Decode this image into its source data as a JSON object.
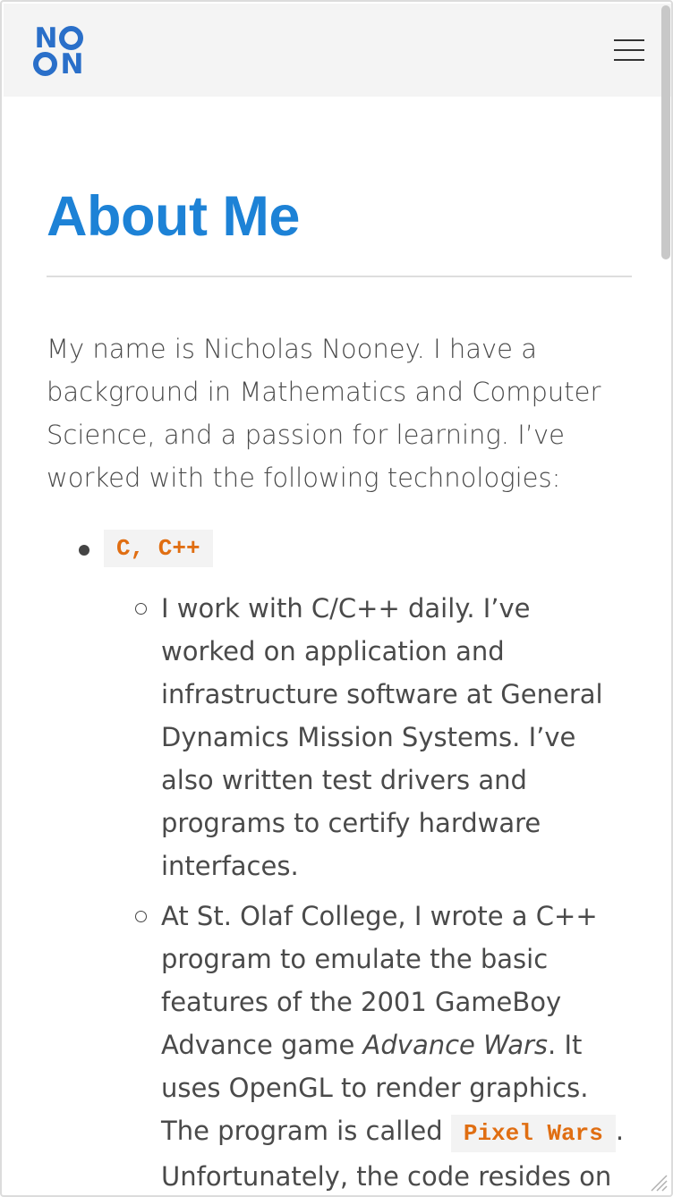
{
  "header": {
    "logo": {
      "letters": [
        "N",
        "O",
        "O",
        "N"
      ]
    },
    "menu_icon": "hamburger-menu-icon"
  },
  "main": {
    "title": "About Me",
    "intro": "My name is Nicholas Nooney. I have a background in Mathematics and Computer Science, and a passion for learning. I’ve worked with the following technologies:",
    "technologies": [
      {
        "label": "C, C++",
        "details": [
          {
            "text": "I work with C/C++ daily. I’ve worked on application and infrastructure software at General Dynamics Mission Systems. I’ve also written test drivers and programs to certify hardware interfaces."
          },
          {
            "text_before": "At St. Olaf College, I wrote a C++ program to emulate the basic features of the 2001 GameBoy Advance game ",
            "game_title": "Advance Wars",
            "text_middle": ". It uses OpenGL to render graphics. The program is called ",
            "program_name": "Pixel Wars",
            "text_after": ". Unfortunately, the code resides on the St. Olaf CS Wiki and"
          }
        ]
      }
    ]
  },
  "colors": {
    "title": "#1d82d6",
    "code_text": "#e06e12",
    "code_bg": "#f3f3f3",
    "header_bg": "#f4f4f4",
    "logo": "#2a6fc9"
  }
}
